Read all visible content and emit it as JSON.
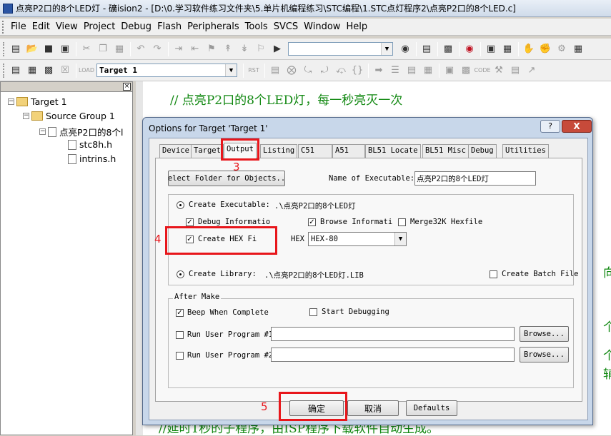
{
  "window": {
    "title": "点亮P2口的8个LED灯  - 礦ision2 - [D:\\0.学习软件练习文件夹\\5.单片机编程练习\\STC编程\\1.STC点灯程序2\\点亮P2口的8个LED.c]"
  },
  "menu": [
    "File",
    "Edit",
    "View",
    "Project",
    "Debug",
    "Flash",
    "Peripherals",
    "Tools",
    "SVCS",
    "Window",
    "Help"
  ],
  "toolbar": {
    "target_combo": "Target 1"
  },
  "project_tree": {
    "target": "Target 1",
    "group": "Source Group 1",
    "file": "点亮P2口的8个l",
    "includes": [
      "stc8h.h",
      "intrins.h"
    ]
  },
  "editor": {
    "comment1": "// 点亮P2口的8个LED灯，每一秒亮灭一次",
    "comment2": "//延时1秒的子程序，由ISP程序下载软件自动生成。",
    "frag1": "向",
    "frag2": "个",
    "frag3": "个",
    "frag4": "辅"
  },
  "dialog": {
    "title": "Options for Target 'Target 1'",
    "help_label": "?",
    "close_label": "X",
    "tabs": [
      "Device",
      "Target",
      "Output",
      "Listing",
      "C51",
      "A51",
      "BL51 Locate",
      "BL51 Misc",
      "Debug",
      "Utilities"
    ],
    "active_tab": "Output",
    "select_folder_button": "Select Folder for Objects...",
    "name_of_executable_label": "Name of Executable:",
    "name_of_executable_value": "点亮P2口的8个LED灯",
    "create_executable_label": "Create Executable:",
    "create_executable_path": ".\\点亮P2口的8个LED灯",
    "debug_info_label": "Debug Informatio",
    "browse_info_label": "Browse Informati",
    "merge32k_label": "Merge32K Hexfile",
    "create_hex_label": "Create HEX Fi",
    "hex_label": "HEX",
    "hex_format": "HEX-80",
    "create_library_label": "Create Library:",
    "create_library_path": ".\\点亮P2口的8个LED灯.LIB",
    "create_batch_label": "Create Batch File",
    "after_make_label": "After Make",
    "beep_label": "Beep When Complete",
    "start_debug_label": "Start Debugging",
    "run_user1_label": "Run User Program #1",
    "run_user2_label": "Run User Program #2",
    "browse1_label": "Browse...",
    "browse2_label": "Browse...",
    "ok_label": "确定",
    "cancel_label": "取消",
    "defaults_label": "Defaults",
    "checks": {
      "debug_info": true,
      "browse_info": true,
      "merge32k": false,
      "create_hex": true,
      "create_batch": false,
      "beep": true,
      "start_debug": false,
      "run_user1": false,
      "run_user2": false
    }
  },
  "annotations": [
    "3",
    "4",
    "5"
  ],
  "colors": {
    "annotation_red": "#e8161b",
    "comment_green": "#118811"
  }
}
